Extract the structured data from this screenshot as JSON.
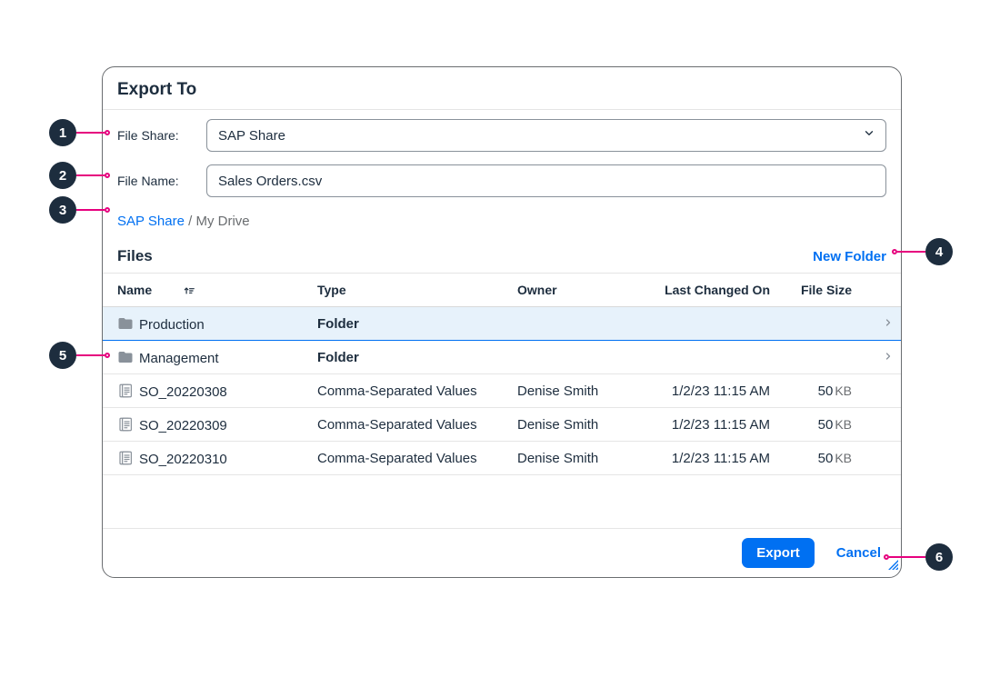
{
  "dialog": {
    "title": "Export To"
  },
  "form": {
    "file_share_label": "File Share:",
    "file_share_value": "SAP Share",
    "file_name_label": "File Name:",
    "file_name_value": "Sales Orders.csv"
  },
  "breadcrumb": {
    "root": "SAP Share",
    "sep": " / ",
    "current": "My Drive"
  },
  "files": {
    "section_title": "Files",
    "new_folder_label": "New Folder",
    "columns": {
      "name": "Name",
      "type": "Type",
      "owner": "Owner",
      "changed": "Last Changed On",
      "size": "File Size"
    },
    "rows": [
      {
        "kind": "folder",
        "name": "Production",
        "type": "Folder",
        "owner": "",
        "changed": "",
        "size": "",
        "unit": "",
        "selected": true,
        "nav": true
      },
      {
        "kind": "folder",
        "name": "Management",
        "type": "Folder",
        "owner": "",
        "changed": "",
        "size": "",
        "unit": "",
        "selected": false,
        "nav": true
      },
      {
        "kind": "file",
        "name": "SO_20220308",
        "type": "Comma-Separated Values",
        "owner": "Denise Smith",
        "changed": "1/2/23 11:15 AM",
        "size": "50",
        "unit": "KB",
        "selected": false,
        "nav": false
      },
      {
        "kind": "file",
        "name": "SO_20220309",
        "type": "Comma-Separated Values",
        "owner": "Denise Smith",
        "changed": "1/2/23 11:15 AM",
        "size": "50",
        "unit": "KB",
        "selected": false,
        "nav": false
      },
      {
        "kind": "file",
        "name": "SO_20220310",
        "type": "Comma-Separated Values",
        "owner": "Denise Smith",
        "changed": "1/2/23 11:15 AM",
        "size": "50",
        "unit": "KB",
        "selected": false,
        "nav": false
      }
    ]
  },
  "footer": {
    "export": "Export",
    "cancel": "Cancel"
  },
  "annotations": [
    "1",
    "2",
    "3",
    "4",
    "5",
    "6"
  ]
}
